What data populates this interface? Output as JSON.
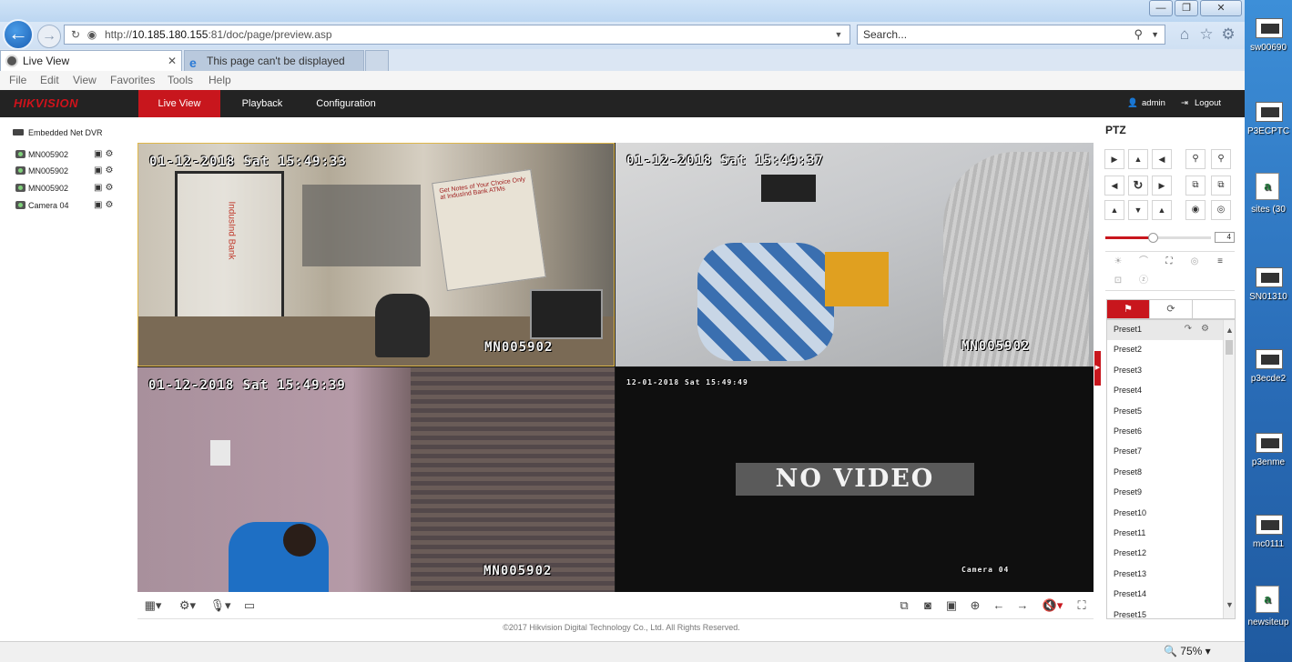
{
  "browser": {
    "address_prefix": "http://",
    "address_host": "10.185.180.155",
    "address_rest": ":81/doc/page/preview.asp",
    "search_placeholder": "Search...",
    "tabs": [
      {
        "label": "Live View",
        "active": true
      },
      {
        "label": "This page can't be displayed",
        "active": false
      }
    ],
    "menu": [
      "File",
      "Edit",
      "View",
      "Favorites",
      "Tools",
      "Help"
    ],
    "zoom_level": "75%"
  },
  "app": {
    "logo": "HIKVISION",
    "nav": [
      {
        "label": "Live View",
        "active": true
      },
      {
        "label": "Playback",
        "active": false
      },
      {
        "label": "Configuration",
        "active": false
      }
    ],
    "user": "admin",
    "logout_label": "Logout",
    "accent_color": "#c8161d"
  },
  "device_tree": {
    "root": "Embedded Net DVR",
    "cameras": [
      "MN005902",
      "MN005902",
      "MN005902",
      "Camera 04"
    ]
  },
  "video": {
    "panes": [
      {
        "timestamp": "01-12-2018 Sat 15:49:33",
        "name": "MN005902",
        "selected": true
      },
      {
        "timestamp": "01-12-2018 Sat 15:49:37",
        "name": "MN005902"
      },
      {
        "timestamp": "01-12-2018 Sat 15:49:39",
        "name": "MN005902"
      },
      {
        "timestamp": "12-01-2018 Sat 15:49:49",
        "name": "Camera 04",
        "no_video": "NO VIDEO"
      }
    ],
    "sign_text": "IndusInd Bank",
    "poster_text": "Get Notes of Your Choice Only at IndusInd Bank ATMs"
  },
  "footer": {
    "copyright": "©2017 Hikvision Digital Technology Co., Ltd. All Rights Reserved."
  },
  "ptz": {
    "title": "PTZ",
    "speed": "4",
    "speed_level": 0.45,
    "presets": [
      "Preset1",
      "Preset2",
      "Preset3",
      "Preset4",
      "Preset5",
      "Preset6",
      "Preset7",
      "Preset8",
      "Preset9",
      "Preset10",
      "Preset11",
      "Preset12",
      "Preset13",
      "Preset14",
      "Preset15"
    ]
  },
  "desktop_icons": [
    {
      "label": "sw00690",
      "type": "image"
    },
    {
      "label": "P3ECPTC",
      "type": "image"
    },
    {
      "label": "sites (30",
      "type": "doc"
    },
    {
      "label": "SN01310",
      "type": "image"
    },
    {
      "label": "p3ecde2",
      "type": "image"
    },
    {
      "label": "p3enme",
      "type": "image"
    },
    {
      "label": "mc0111",
      "type": "image"
    },
    {
      "label": "newsiteup",
      "type": "doc"
    }
  ]
}
